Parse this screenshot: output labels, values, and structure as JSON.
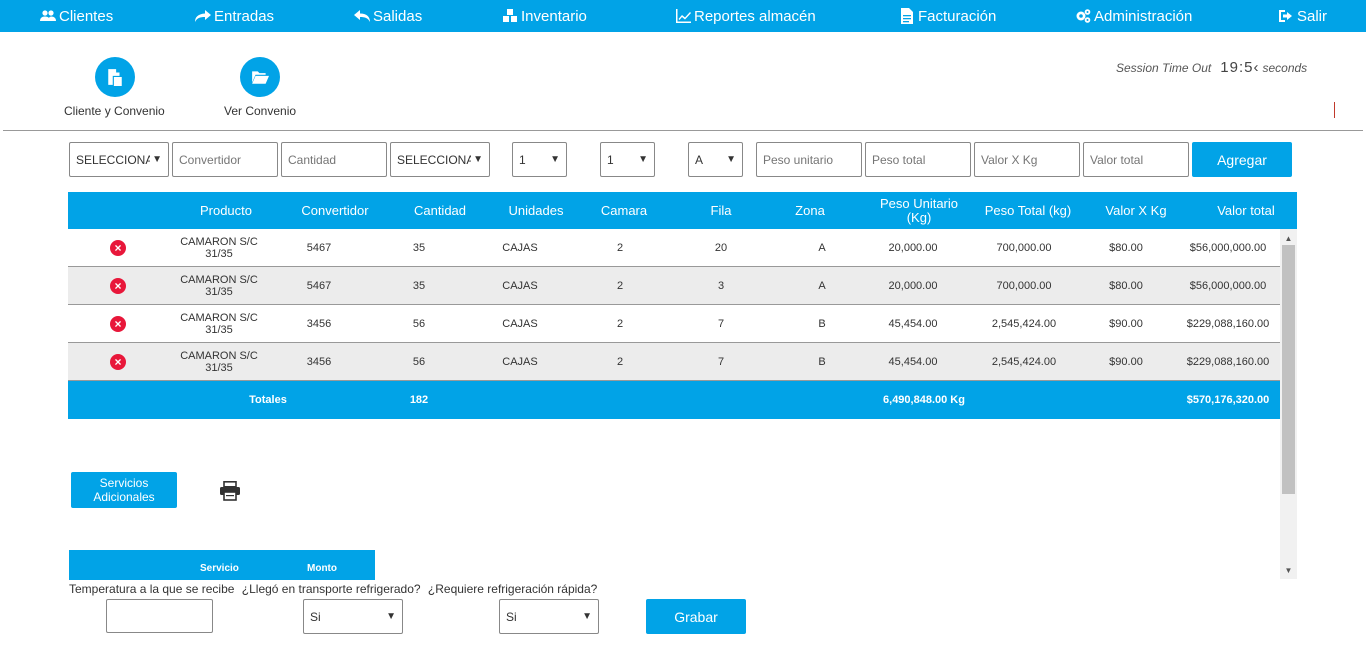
{
  "nav": [
    {
      "label": "Clientes",
      "icon": "users-icon"
    },
    {
      "label": "Entradas",
      "icon": "share-arrow-icon"
    },
    {
      "label": "Salidas",
      "icon": "reply-arrow-icon"
    },
    {
      "label": "Inventario",
      "icon": "cubes-icon"
    },
    {
      "label": "Reportes almacén",
      "icon": "line-chart-icon"
    },
    {
      "label": "Facturación",
      "icon": "document-icon"
    },
    {
      "label": "Administración",
      "icon": "gears-icon"
    },
    {
      "label": "Salir",
      "icon": "sign-out-icon"
    }
  ],
  "actions": {
    "client_label": "Cliente y Convenio",
    "agreement_label": "Ver Convenio"
  },
  "session": {
    "label": "Session Time Out",
    "time": "19:5‹",
    "unit": "seconds"
  },
  "form": {
    "product_select": "SELECCIONAR",
    "converter_placeholder": "Convertidor",
    "quantity_placeholder": "Cantidad",
    "unit_select": "SELECCIONAR",
    "camera_select": "1",
    "row_select": "1",
    "zone_select": "A",
    "unit_weight_placeholder": "Peso unitario",
    "total_weight_placeholder": "Peso total",
    "value_kg_placeholder": "Valor X Kg",
    "total_value_placeholder": "Valor total",
    "add_label": "Agregar"
  },
  "table": {
    "headers": {
      "product": "Producto",
      "converter": "Convertidor",
      "quantity": "Cantidad",
      "units": "Unidades",
      "camera": "Camara",
      "row": "Fila",
      "zone": "Zona",
      "unit_weight": "Peso Unitario (Kg)",
      "total_weight": "Peso Total (kg)",
      "value_kg": "Valor X Kg",
      "total_value": "Valor total"
    },
    "rows": [
      {
        "product": "CAMARON S/C 31/35",
        "converter": "5467",
        "quantity": "35",
        "units": "CAJAS",
        "camera": "2",
        "row": "20",
        "zone": "A",
        "unit_weight": "20,000.00",
        "total_weight": "700,000.00",
        "value_kg": "$80.00",
        "total_value": "$56,000,000.00"
      },
      {
        "product": "CAMARON S/C 31/35",
        "converter": "5467",
        "quantity": "35",
        "units": "CAJAS",
        "camera": "2",
        "row": "3",
        "zone": "A",
        "unit_weight": "20,000.00",
        "total_weight": "700,000.00",
        "value_kg": "$80.00",
        "total_value": "$56,000,000.00"
      },
      {
        "product": "CAMARON S/C 31/35",
        "converter": "3456",
        "quantity": "56",
        "units": "CAJAS",
        "camera": "2",
        "row": "7",
        "zone": "B",
        "unit_weight": "45,454.00",
        "total_weight": "2,545,424.00",
        "value_kg": "$90.00",
        "total_value": "$229,088,160.00"
      },
      {
        "product": "CAMARON S/C 31/35",
        "converter": "3456",
        "quantity": "56",
        "units": "CAJAS",
        "camera": "2",
        "row": "7",
        "zone": "B",
        "unit_weight": "45,454.00",
        "total_weight": "2,545,424.00",
        "value_kg": "$90.00",
        "total_value": "$229,088,160.00"
      }
    ],
    "totals": {
      "label": "Totales",
      "quantity": "182",
      "weight": "6,490,848.00 Kg",
      "value": "$570,176,320.00"
    }
  },
  "services": {
    "button_label": "Servicios Adicionales",
    "col_service": "Servicio",
    "col_amount": "Monto"
  },
  "questions": {
    "temperature": "Temperatura a la que se recibe",
    "refrigerated_transport": "¿Llegó en transporte refrigerado?",
    "fast_refrigeration": "¿Requiere refrigeración rápida?",
    "refrigerated_value": "Si",
    "fast_value": "Si",
    "save_label": "Grabar"
  },
  "colors": {
    "accent": "#01a3e7",
    "delete": "#e8173a"
  }
}
